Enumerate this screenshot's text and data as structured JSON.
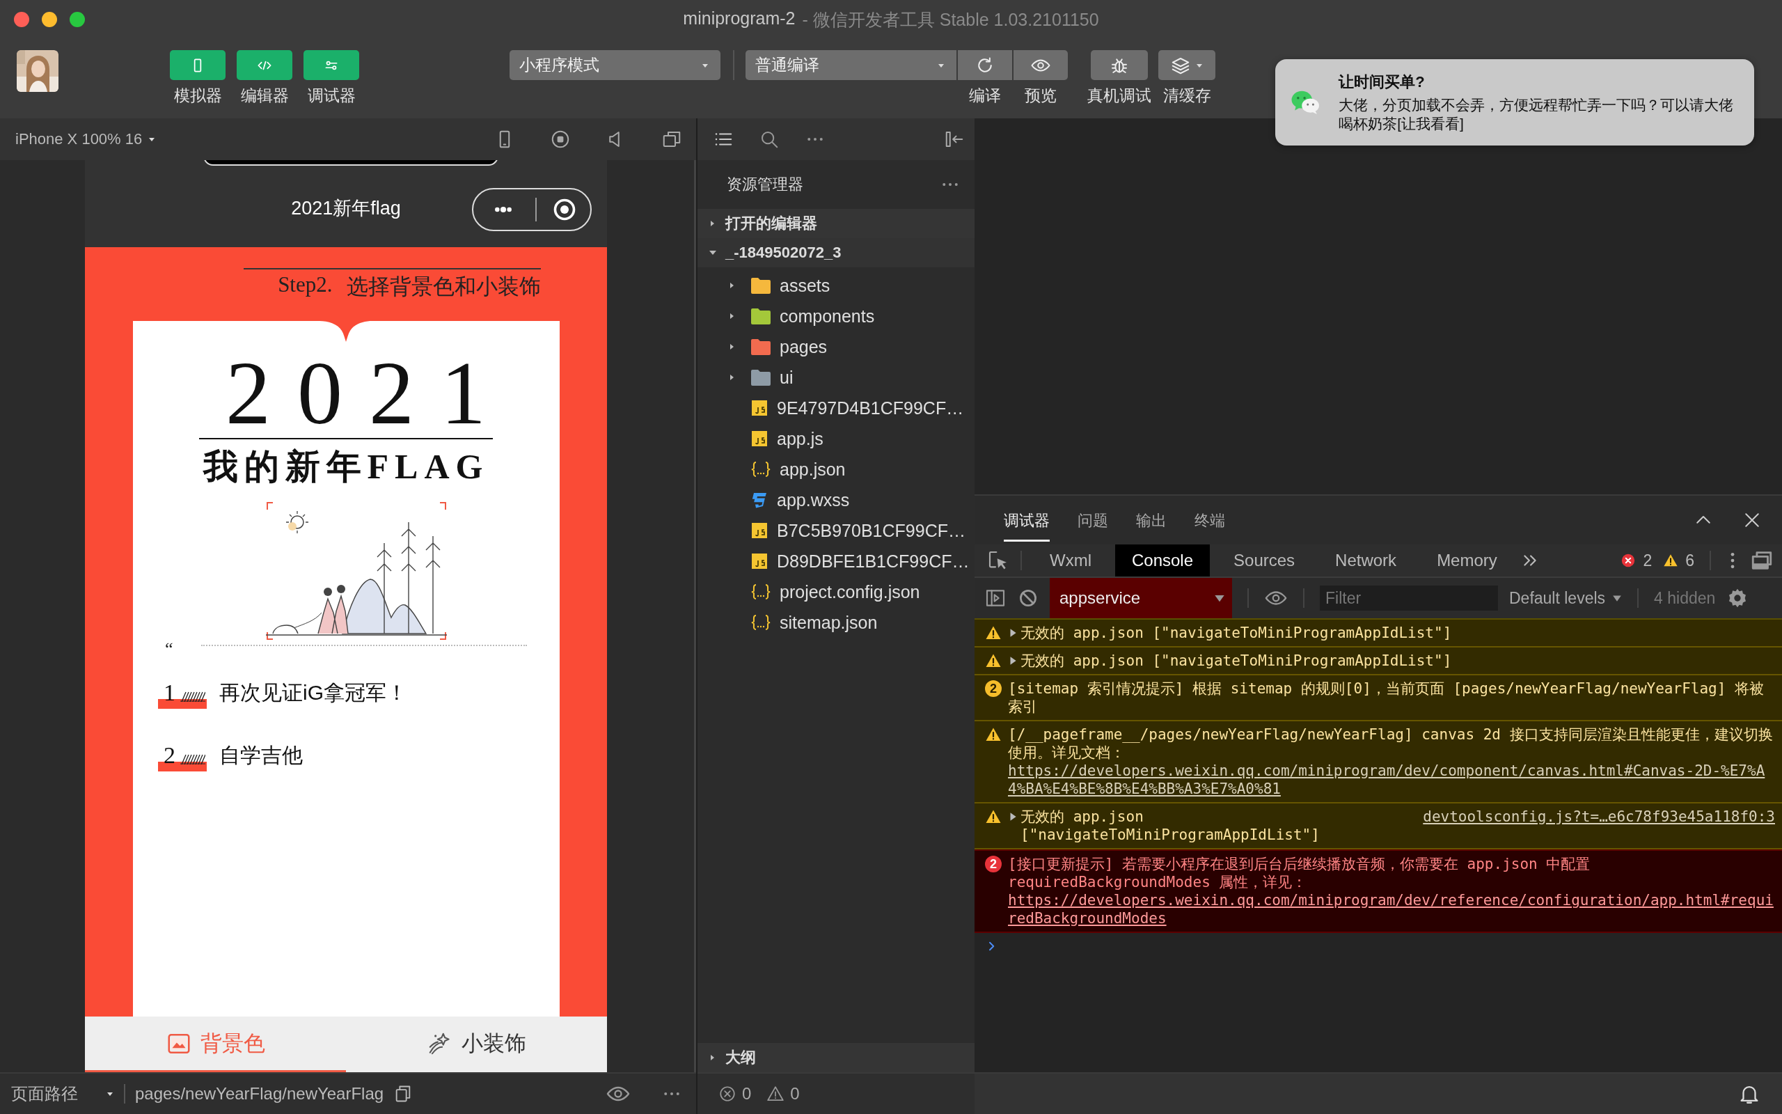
{
  "window": {
    "title": "miniprogram-2",
    "subtitle": "- 微信开发者工具 Stable 1.03.2101150"
  },
  "toolbar": {
    "view_buttons": [
      {
        "label": "模拟器",
        "on": true
      },
      {
        "label": "编辑器",
        "on": true
      },
      {
        "label": "调试器",
        "on": true
      }
    ],
    "mode_select": "小程序模式",
    "compile_select": "普通编译",
    "actions": [
      {
        "label": "编译"
      },
      {
        "label": "预览"
      },
      {
        "label": "真机调试"
      },
      {
        "label": "清缓存"
      }
    ]
  },
  "notification": {
    "title": "让时间买单?",
    "body": "大佬，分页加载不会弄，方便远程帮忙弄一下吗？可以请大佬喝杯奶茶[让我看看]"
  },
  "simulator": {
    "device": "iPhone X 100% 16",
    "page": {
      "nav_title": "2021新年flag",
      "step_number": "Step2.",
      "step_title": "选择背景色和小装饰",
      "year": "2021",
      "heading": "我的新年FLAG",
      "quote_mark": "“",
      "flags": [
        {
          "number": "1",
          "text": "再次见证iG拿冠军！"
        },
        {
          "number": "2",
          "text": "自学吉他"
        }
      ],
      "tabs": [
        {
          "label": "背景色",
          "selected": true
        },
        {
          "label": "小装饰",
          "selected": false
        }
      ]
    },
    "path_label": "页面路径",
    "path": "pages/newYearFlag/newYearFlag"
  },
  "explorer": {
    "title": "资源管理器",
    "open_editors": {
      "label": "打开的编辑器",
      "expanded": false
    },
    "project": {
      "label": "_-1849502072_3",
      "expanded": true,
      "children": [
        {
          "name": "assets",
          "kind": "folder",
          "color": "#f5b83d",
          "expanded": false
        },
        {
          "name": "components",
          "kind": "folder",
          "color": "#a4c83a",
          "expanded": false
        },
        {
          "name": "pages",
          "kind": "folder",
          "color": "#f26b4f",
          "expanded": false
        },
        {
          "name": "ui",
          "kind": "folder",
          "color": "#8e9ba6",
          "expanded": false
        },
        {
          "name": "9E4797D4B1CF99CF…",
          "kind": "js"
        },
        {
          "name": "app.js",
          "kind": "js"
        },
        {
          "name": "app.json",
          "kind": "json"
        },
        {
          "name": "app.wxss",
          "kind": "wxss"
        },
        {
          "name": "B7C5B970B1CF99CF…",
          "kind": "js"
        },
        {
          "name": "D89DBFE1B1CF99CF…",
          "kind": "js"
        },
        {
          "name": "project.config.json",
          "kind": "json"
        },
        {
          "name": "sitemap.json",
          "kind": "json"
        }
      ]
    },
    "outline": {
      "label": "大纲",
      "expanded": false
    },
    "errors": "0",
    "warnings": "0"
  },
  "debugger": {
    "tabs": [
      {
        "label": "调试器",
        "selected": true
      },
      {
        "label": "问题",
        "selected": false
      },
      {
        "label": "输出",
        "selected": false
      },
      {
        "label": "终端",
        "selected": false
      }
    ],
    "devtools_tabs": [
      {
        "label": "Wxml",
        "selected": false
      },
      {
        "label": "Console",
        "selected": true
      },
      {
        "label": "Sources",
        "selected": false
      },
      {
        "label": "Network",
        "selected": false
      },
      {
        "label": "Memory",
        "selected": false
      }
    ],
    "error_count": "2",
    "warning_count": "6",
    "context": "appservice",
    "filter_placeholder": "Filter",
    "levels": "Default levels",
    "hidden_count": "4 hidden",
    "messages": [
      {
        "kind": "warning",
        "expandable": true,
        "text": "无效的 app.json [\"navigateToMiniProgramAppIdList\"]"
      },
      {
        "kind": "warning",
        "expandable": true,
        "text": "无效的 app.json [\"navigateToMiniProgramAppIdList\"]"
      },
      {
        "kind": "warning",
        "expandable": false,
        "count": "2",
        "text": "[sitemap 索引情况提示] 根据 sitemap 的规则[0]，当前页面 [pages/newYearFlag/newYearFlag] 将被索引"
      },
      {
        "kind": "warning",
        "expandable": false,
        "text": "[/__pageframe__/pages/newYearFlag/newYearFlag] canvas 2d 接口支持同层渲染且性能更佳，建议切换使用。详见文档：",
        "link": "https://developers.weixin.qq.com/miniprogram/dev/component/canvas.html#Canvas-2D-%E7%A4%BA%E4%BE%8B%E4%BB%A3%E7%A0%81"
      },
      {
        "kind": "warning",
        "expandable": true,
        "text": "无效的 app.json [\"navigateToMiniProgramAppIdList\"]",
        "source": "devtoolsconfig.js?t=…e6c78f93e45a118f0:3"
      },
      {
        "kind": "error",
        "expandable": false,
        "count": "2",
        "text": "[接口更新提示] 若需要小程序在退到后台后继续播放音频，你需要在 app.json 中配置 requiredBackgroundModes 属性，详见：",
        "link": "https://developers.weixin.qq.com/miniprogram/dev/reference/configuration/app.html#requiredBackgroundModes"
      }
    ]
  }
}
